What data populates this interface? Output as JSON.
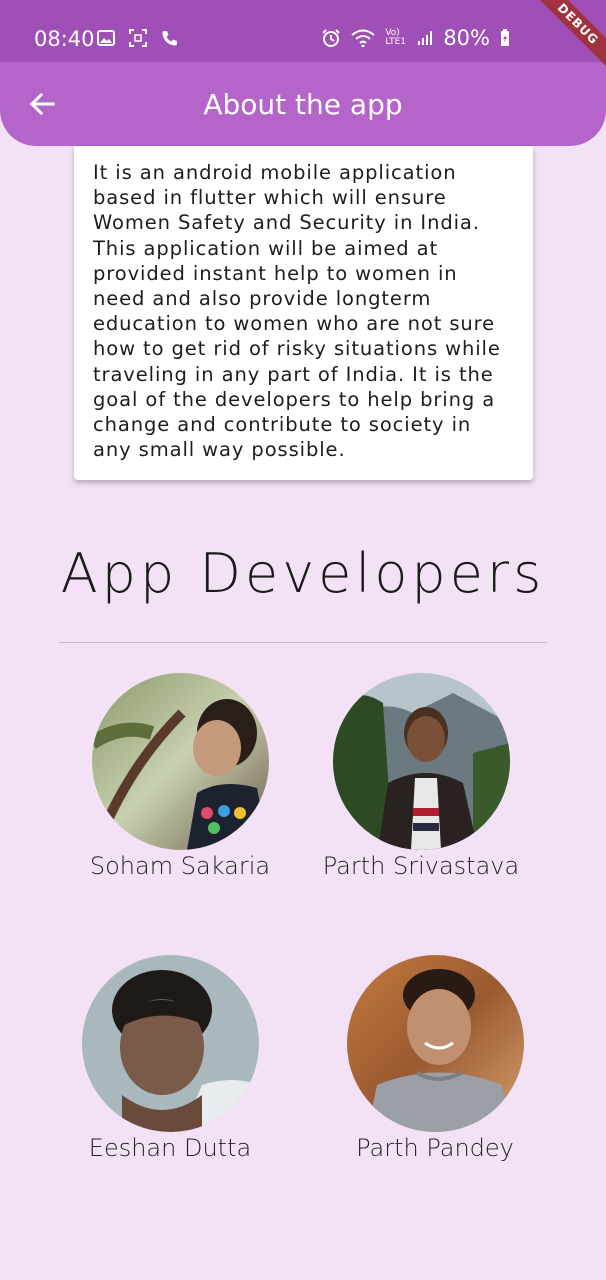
{
  "status_bar": {
    "time": "08:40",
    "battery": "80%",
    "network_label": "Vo) LTE1",
    "debug_label": "DEBUG"
  },
  "app_bar": {
    "title": "About the app",
    "back_icon": "arrow-back-icon"
  },
  "about": {
    "text": "It is an android mobile application based in flutter which will ensure Women Safety and Security in India. This application will be aimed at provided instant help to women in need and also provide longterm education to women who are not sure how to get rid of risky situations while traveling in any part of India. It is the goal of the developers to help bring a change and contribute to society in any small way possible."
  },
  "developers_section": {
    "title": "App Developers",
    "developers": [
      {
        "name": "Soham Sakaria"
      },
      {
        "name": "Parth Srivastava"
      },
      {
        "name": "Eeshan Dutta"
      },
      {
        "name": "Parth Pandey"
      }
    ]
  },
  "colors": {
    "app_bar": "#b564c9",
    "status_bar": "#a04fb6",
    "background": "#f3e2f6",
    "debug_banner": "#a1323f"
  }
}
